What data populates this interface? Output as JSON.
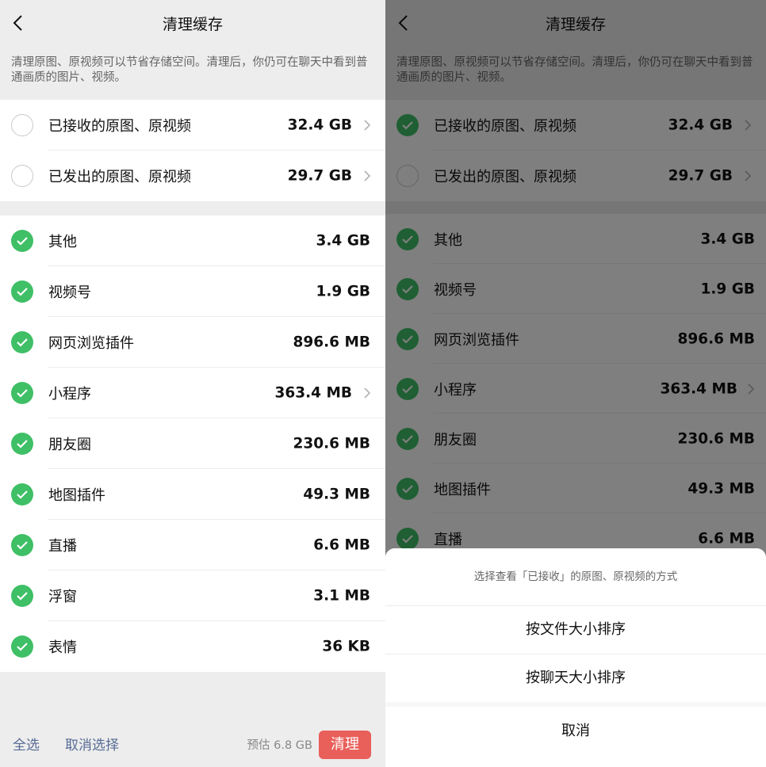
{
  "page": {
    "title": "清理缓存",
    "description": "清理原图、原视频可以节省存储空间。清理后，你仍可在聊天中看到普通画质的图片、视频。"
  },
  "original_media": [
    {
      "label": "已接收的原图、原视频",
      "size": "32.4 GB"
    },
    {
      "label": "已发出的原图、原视频",
      "size": "29.7 GB"
    }
  ],
  "cache_items": [
    {
      "label": "其他",
      "size": "3.4 GB"
    },
    {
      "label": "视频号",
      "size": "1.9 GB"
    },
    {
      "label": "网页浏览插件",
      "size": "896.6 MB"
    },
    {
      "label": "小程序",
      "size": "363.4 MB"
    },
    {
      "label": "朋友圈",
      "size": "230.6 MB"
    },
    {
      "label": "地图插件",
      "size": "49.3 MB"
    },
    {
      "label": "直播",
      "size": "6.6 MB"
    },
    {
      "label": "浮窗",
      "size": "3.1 MB"
    },
    {
      "label": "表情",
      "size": "36 KB"
    }
  ],
  "footer": {
    "select_all": "全选",
    "deselect": "取消选择",
    "estimate": "预估 6.8 GB",
    "clean": "清理"
  },
  "action_sheet": {
    "title": "选择查看「已接收」的原图、原视频的方式",
    "option_by_file": "按文件大小排序",
    "option_by_chat": "按聊天大小排序",
    "cancel": "取消"
  },
  "colors": {
    "check_green": "#3fbf66",
    "clean_red": "#e95f5a",
    "link_blue": "#576b95"
  }
}
